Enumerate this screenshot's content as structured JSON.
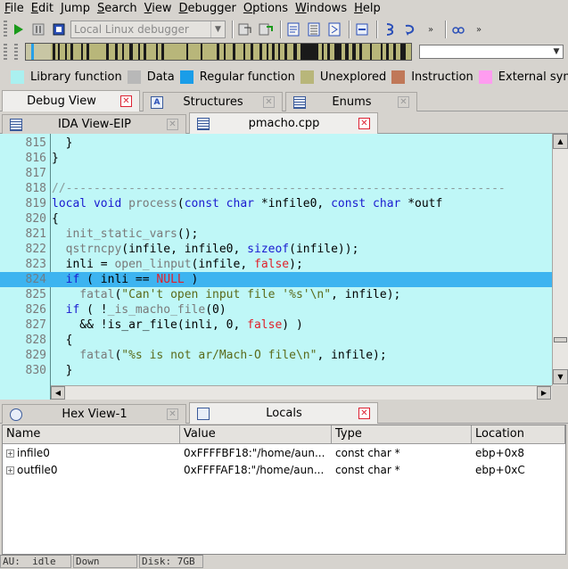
{
  "menu": [
    "File",
    "Edit",
    "Jump",
    "Search",
    "View",
    "Debugger",
    "Options",
    "Windows",
    "Help"
  ],
  "toolbar": {
    "debugger_select": "Local Linux debugger"
  },
  "legend": [
    {
      "label": "Library function",
      "color": "#aaf0f0"
    },
    {
      "label": "Data",
      "color": "#b8b8b8"
    },
    {
      "label": "Regular function",
      "color": "#1a9de8"
    },
    {
      "label": "Unexplored",
      "color": "#b8b67a"
    },
    {
      "label": "Instruction",
      "color": "#c07858"
    },
    {
      "label": "External symbol",
      "color": "#ff9cf0"
    }
  ],
  "tabs_top": [
    {
      "label": "Debug View",
      "close": "red"
    },
    {
      "label": "Structures",
      "close": "grey"
    },
    {
      "label": "Enums",
      "close": "grey"
    }
  ],
  "tabs_views": [
    {
      "label": "IDA View-EIP",
      "close": "grey"
    },
    {
      "label": "pmacho.cpp",
      "close": "red"
    }
  ],
  "code": [
    {
      "ln": "815",
      "highlight": false,
      "tokens": [
        [
          "p",
          "  }"
        ]
      ]
    },
    {
      "ln": "816",
      "highlight": false,
      "tokens": [
        [
          "p",
          "}"
        ]
      ]
    },
    {
      "ln": "817",
      "highlight": false,
      "tokens": [
        [
          "p",
          ""
        ]
      ]
    },
    {
      "ln": "818",
      "highlight": false,
      "tokens": [
        [
          "c",
          "//---------------------------------------------------------------"
        ]
      ]
    },
    {
      "ln": "819",
      "highlight": false,
      "tokens": [
        [
          "k",
          "local void "
        ],
        [
          "f",
          "process"
        ],
        [
          "p",
          "("
        ],
        [
          "k",
          "const char "
        ],
        [
          "p",
          "*infile0, "
        ],
        [
          "k",
          "const char "
        ],
        [
          "p",
          "*outf"
        ]
      ]
    },
    {
      "ln": "820",
      "highlight": false,
      "tokens": [
        [
          "p",
          "{"
        ]
      ]
    },
    {
      "ln": "821",
      "highlight": false,
      "tokens": [
        [
          "f",
          "  init_static_vars"
        ],
        [
          "p",
          "();"
        ]
      ]
    },
    {
      "ln": "822",
      "highlight": false,
      "tokens": [
        [
          "f",
          "  qstrncpy"
        ],
        [
          "p",
          "(infile, infile0, "
        ],
        [
          "k",
          "sizeof"
        ],
        [
          "p",
          "(infile));"
        ]
      ]
    },
    {
      "ln": "823",
      "highlight": false,
      "tokens": [
        [
          "p",
          "  inli = "
        ],
        [
          "f",
          "open_linput"
        ],
        [
          "p",
          "(infile, "
        ],
        [
          "r",
          "false"
        ],
        [
          "p",
          ");"
        ]
      ]
    },
    {
      "ln": "824",
      "highlight": true,
      "tokens": [
        [
          "k",
          "  if "
        ],
        [
          "p",
          "( inli == "
        ],
        [
          "r",
          "NULL"
        ],
        [
          "p",
          " )"
        ]
      ]
    },
    {
      "ln": "825",
      "highlight": false,
      "tokens": [
        [
          "f",
          "    fatal"
        ],
        [
          "p",
          "("
        ],
        [
          "s",
          "\"Can't open input file '%s'\\n\""
        ],
        [
          "p",
          ", infile);"
        ]
      ]
    },
    {
      "ln": "826",
      "highlight": false,
      "tokens": [
        [
          "k",
          "  if "
        ],
        [
          "p",
          "( !"
        ],
        [
          "f",
          "_is_macho_file"
        ],
        [
          "p",
          "(0)"
        ]
      ]
    },
    {
      "ln": "827",
      "highlight": false,
      "tokens": [
        [
          "p",
          "    && !is_ar_file(inli, 0, "
        ],
        [
          "r",
          "false"
        ],
        [
          "p",
          ") )"
        ]
      ]
    },
    {
      "ln": "828",
      "highlight": false,
      "tokens": [
        [
          "p",
          "  {"
        ]
      ]
    },
    {
      "ln": "829",
      "highlight": false,
      "tokens": [
        [
          "f",
          "    fatal"
        ],
        [
          "p",
          "("
        ],
        [
          "s",
          "\"%s is not ar/Mach-O file\\n\""
        ],
        [
          "p",
          ", infile);"
        ]
      ]
    },
    {
      "ln": "830",
      "highlight": false,
      "tokens": [
        [
          "p",
          "  }"
        ]
      ]
    }
  ],
  "tabs_bottom": [
    {
      "label": "Hex View-1",
      "close": "grey"
    },
    {
      "label": "Locals",
      "close": "red"
    }
  ],
  "locals": {
    "columns": [
      "Name",
      "Value",
      "Type",
      "Location"
    ],
    "rows": [
      {
        "name": "infile0",
        "value": "0xFFFFBF18:\"/home/aun...",
        "type": "const char *",
        "location": "ebp+0x8"
      },
      {
        "name": "outfile0",
        "value": "0xFFFFAF18:\"/home/aun...",
        "type": "const char *",
        "location": "ebp+0xC"
      }
    ]
  },
  "status": {
    "au": "AU:  idle",
    "dir": "Down",
    "disk": "Disk: 7GB"
  }
}
